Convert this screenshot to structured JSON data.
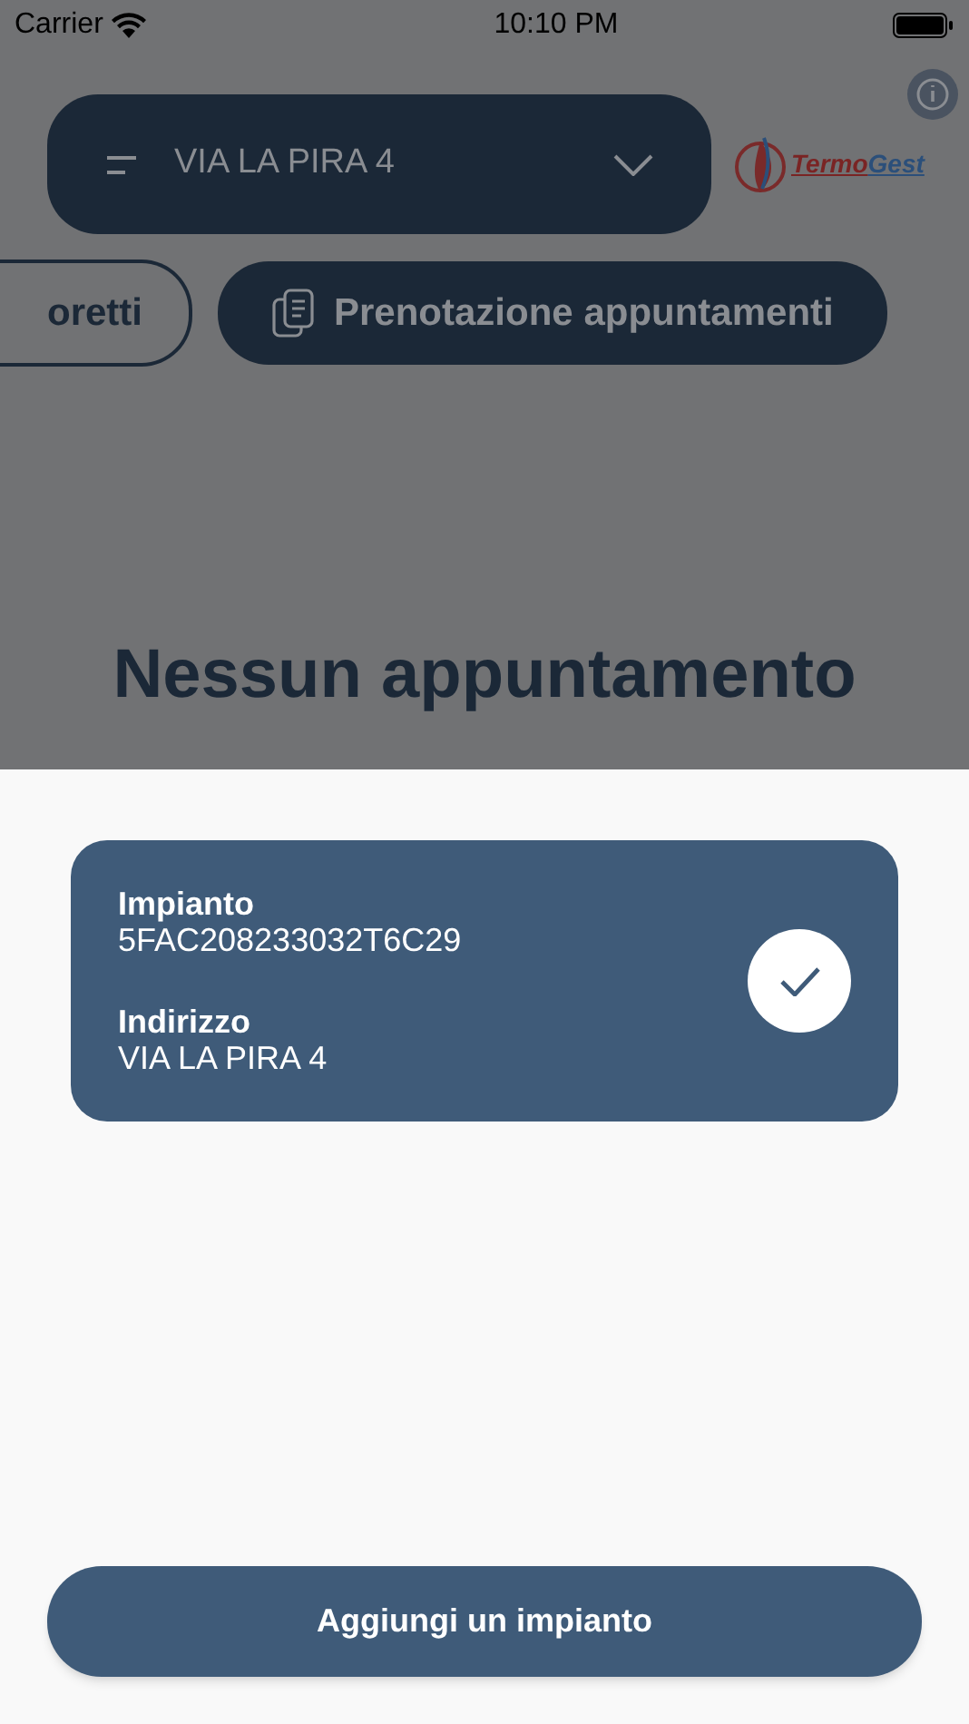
{
  "status_bar": {
    "carrier": "Carrier",
    "time": "10:10 PM"
  },
  "header": {
    "address_selector": "VIA LA PIRA 4",
    "logo": {
      "part_1": "Termo",
      "part_2": "Gest"
    }
  },
  "tabs": [
    {
      "label": "oretti",
      "selected": false
    },
    {
      "label": "Prenotazione appuntamenti",
      "selected": true
    }
  ],
  "empty_title": "Nessun appuntamento",
  "sheet": {
    "plants": [
      {
        "plant_label": "Impianto",
        "plant_code": "5FAC208233032T6C29",
        "address_label": "Indirizzo",
        "address": "VIA LA PIRA 4",
        "selected": true
      }
    ],
    "add_button": "Aggiungi un impianto"
  }
}
